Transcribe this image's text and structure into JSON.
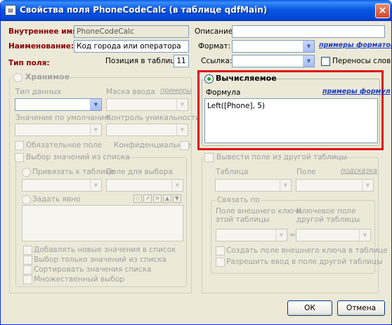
{
  "window": {
    "title": "Свойства поля PhoneCodeCalc (в таблице qdfMain)",
    "app_icon": "dialog-icon",
    "close": "×"
  },
  "top": {
    "internal_name_label": "Внутреннее имя:",
    "internal_name_value": "PhoneCodeCalc",
    "caption_label": "Наименование:",
    "caption_value": "Код города или оператора",
    "field_type_label": "Тип поля:",
    "position_label": "Позиция в таблице:",
    "position_value": "11",
    "description_label": "Описание:",
    "description_value": "",
    "format_label": "Формат:",
    "format_value": "",
    "format_examples": "примеры форматов",
    "link_label": "Ссылка:",
    "link_value": "",
    "wrap_label": "Переносы слов",
    "wrap_checked": false
  },
  "stored": {
    "title": "Хранимое",
    "selected": false,
    "data_type_label": "Тип данных",
    "input_mask_label": "Маска ввода",
    "examples_link": "примеры",
    "default_label": "Значение по умолчанию",
    "unique_label": "Контроль уникальности",
    "required_label": "Обязательное поле",
    "confidential_label": "Конфиденциальное",
    "list_choice_label": "Выбор значений из списка",
    "bind_table_label": "Привязать к таблице",
    "choice_field_label": "Поле для выбора",
    "explicit_label": "Задать явно",
    "toolbar": [
      "◇",
      "↗",
      "✕",
      "▲",
      "▼"
    ],
    "options": [
      "Добавлять новые значения в список",
      "Выбор только значений из списка",
      "Сортировать значения списка",
      "Множественный выбор"
    ]
  },
  "calc": {
    "title": "Вычисляемое",
    "selected": true,
    "formula_label": "Формула",
    "formula_examples": "примеры формул",
    "formula_value": "Left([Phone], 5)"
  },
  "other": {
    "show_other_label": "Вывести поле из другой таблицы",
    "table_label": "Таблица",
    "field_label": "Поле",
    "hint_link": "подсказка",
    "link_group_title": "Связать по",
    "fk_field_label1": "Поле внешнего ключа",
    "fk_field_label2": "этой таблицы",
    "key_field_label1": "Ключевое поле",
    "key_field_label2": "другой таблицы",
    "eq": "=",
    "create_fk_label": "Создать поле внешнего ключа в таблице",
    "allow_input_label": "Разрешить ввод в поле другой таблицы"
  },
  "buttons": {
    "ok": "ОК",
    "cancel": "Отмена"
  },
  "colors": {
    "highlight_border": "#e01010",
    "title_bar": "#0a5ce8",
    "label_red": "#8b0000",
    "link_blue": "#1a3cc8"
  }
}
